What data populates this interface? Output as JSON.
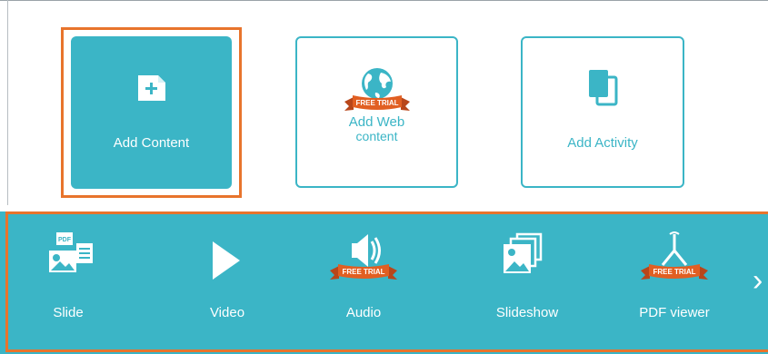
{
  "content_cards": {
    "add_content": "Add Content",
    "add_web_line1": "Add Web",
    "add_web_line2": "content",
    "add_activity": "Add Activity"
  },
  "badge": {
    "free_trial": "FREE TRIAL"
  },
  "toolbar": {
    "items": [
      {
        "label": "Slide",
        "icon": "slide-icon"
      },
      {
        "label": "Video",
        "icon": "video-icon"
      },
      {
        "label": "Audio",
        "icon": "audio-icon",
        "badge": true
      },
      {
        "label": "Slideshow",
        "icon": "slideshow-icon"
      },
      {
        "label": "PDF viewer",
        "icon": "pdf-icon",
        "badge": true
      }
    ],
    "more": "›"
  },
  "colors": {
    "teal": "#3bb5c6",
    "highlight": "#e8742c",
    "ribbon": "#d9541e"
  }
}
